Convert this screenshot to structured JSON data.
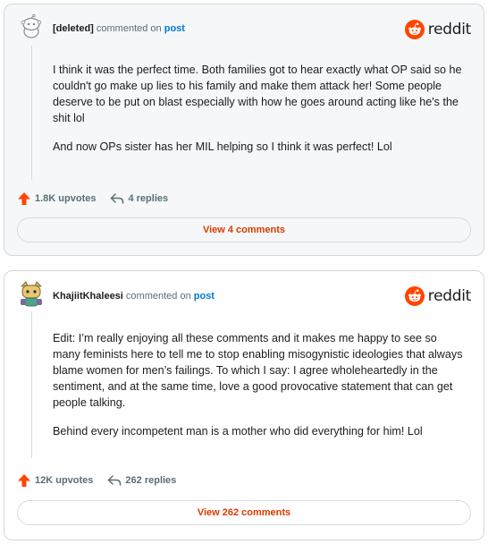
{
  "comments": [
    {
      "username": "[deleted]",
      "commented_on": "commented on",
      "post_link": "post",
      "logo_text": "reddit",
      "body": [
        "I think it was the perfect time. Both families got to hear exactly what OP said so he couldn't go make up lies to his family and make them attack her! Some people deserve to be put on blast especially with how he goes around acting like he's the shit lol",
        "And now OPs sister has her MIL helping so I think it was perfect! Lol"
      ],
      "upvotes": "1.8K upvotes",
      "replies": "4 replies",
      "view_label": "View 4 comments"
    },
    {
      "username": "KhajiitKhaleesi",
      "commented_on": "commented on",
      "post_link": "post",
      "logo_text": "reddit",
      "body": [
        "Edit: I’m really enjoying all these comments and it makes me happy to see so many feminists here to tell me to stop enabling misogynistic ideologies that always blame women for men’s failings. To which I say: I agree wholeheartedly in the sentiment, and at the same time, love a good provocative statement that can get people talking.",
        "Behind every incompetent man is a mother who did everything for him! Lol"
      ],
      "upvotes": "12K upvotes",
      "replies": "262 replies",
      "view_label": "View 262 comments"
    }
  ],
  "colors": {
    "upvote": "#ff4500",
    "brand": "#ff4500",
    "link": "#0079d3",
    "view_button_text": "#d93a00"
  },
  "icons": {
    "avatar_1": "snoo-deleted-avatar-icon",
    "avatar_2": "snoo-custom-avatar-icon",
    "logo": "reddit-snoo-icon",
    "upvote": "upvote-arrow-icon",
    "reply": "reply-arrow-icon"
  }
}
